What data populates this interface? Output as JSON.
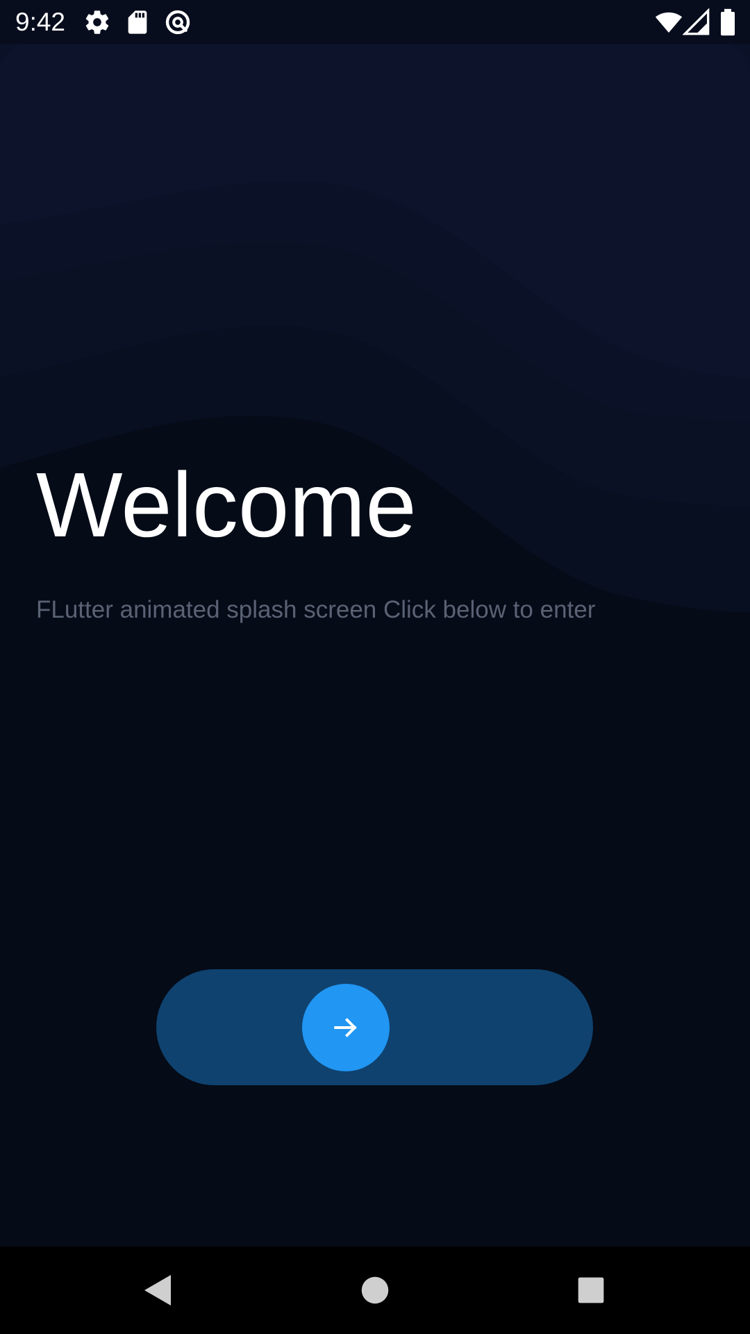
{
  "status_bar": {
    "time": "9:42",
    "left_icons": [
      "gear-icon",
      "sd-card-icon",
      "data-saver-icon"
    ],
    "right_icons": [
      "wifi-icon",
      "cell-signal-icon",
      "battery-icon"
    ]
  },
  "main": {
    "title": "Welcome",
    "subtitle": "FLutter animated splash screen Click below to enter"
  },
  "slider": {
    "knob_icon": "arrow-right-icon"
  },
  "nav_bar": {
    "buttons": [
      "back-icon",
      "home-icon",
      "recents-icon"
    ]
  },
  "colors": {
    "background": "#050b17",
    "wave_top": "#0c1329",
    "slider_track": "#0f426f",
    "slider_knob": "#2196f3",
    "subtitle": "#5a6274"
  }
}
